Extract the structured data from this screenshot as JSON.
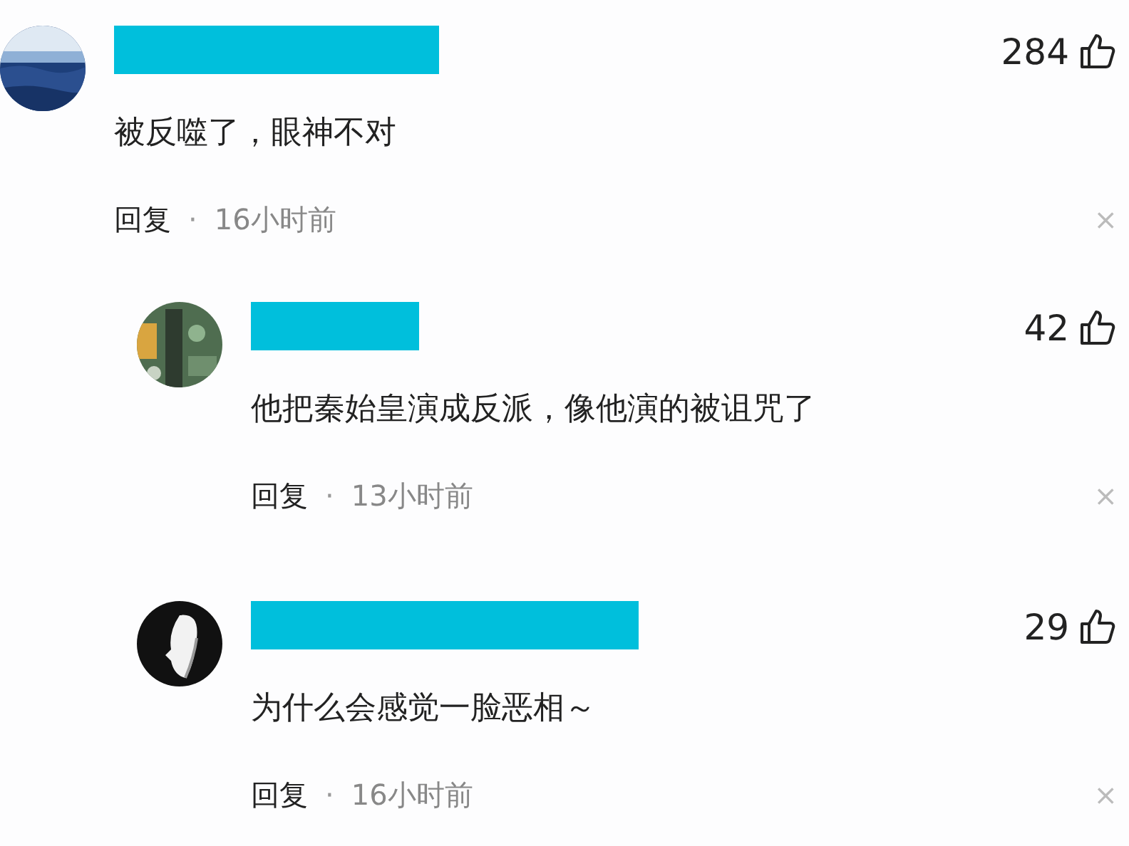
{
  "comments": [
    {
      "text": "被反噬了，眼神不对",
      "likes": "284",
      "reply": "回复",
      "separator": "·",
      "time": "16小时前",
      "close": "×",
      "nested": false
    },
    {
      "text": "他把秦始皇演成反派，像他演的被诅咒了",
      "likes": "42",
      "reply": "回复",
      "separator": "·",
      "time": "13小时前",
      "close": "×",
      "nested": true
    },
    {
      "text": "为什么会感觉一脸恶相～",
      "likes": "29",
      "reply": "回复",
      "separator": "·",
      "time": "16小时前",
      "close": "×",
      "nested": true
    }
  ]
}
